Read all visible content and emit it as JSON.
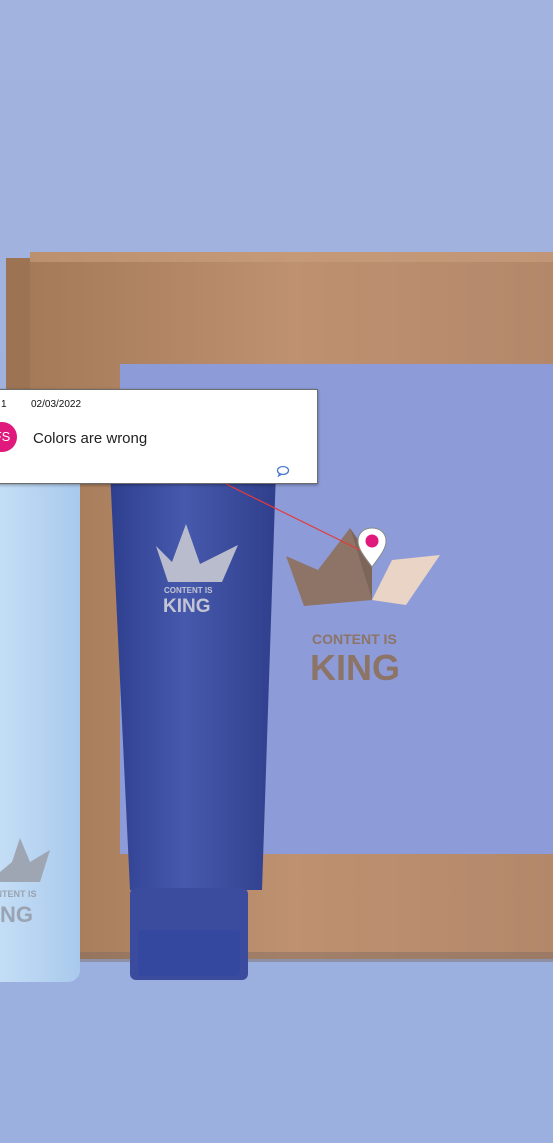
{
  "comment": {
    "number": "1",
    "date": "02/03/2022",
    "author_initials": "FS",
    "text": "Colors are wrong"
  },
  "box_logo": {
    "line1": "CONTENT IS",
    "line2": "KING"
  },
  "tube_logo": {
    "line1": "CONTENT IS",
    "line2": "KING"
  },
  "bottle_logo": {
    "line1": "CONTENT IS",
    "line2": "KING"
  },
  "colors": {
    "backdrop": "#9fb0de",
    "cardboard": "#b98a68",
    "tube": "#3d4fa0",
    "bottle": "#b8d6f3",
    "pin": "#e0197d"
  },
  "icons": [
    "map-pin-icon",
    "comment-bubble-icon"
  ]
}
